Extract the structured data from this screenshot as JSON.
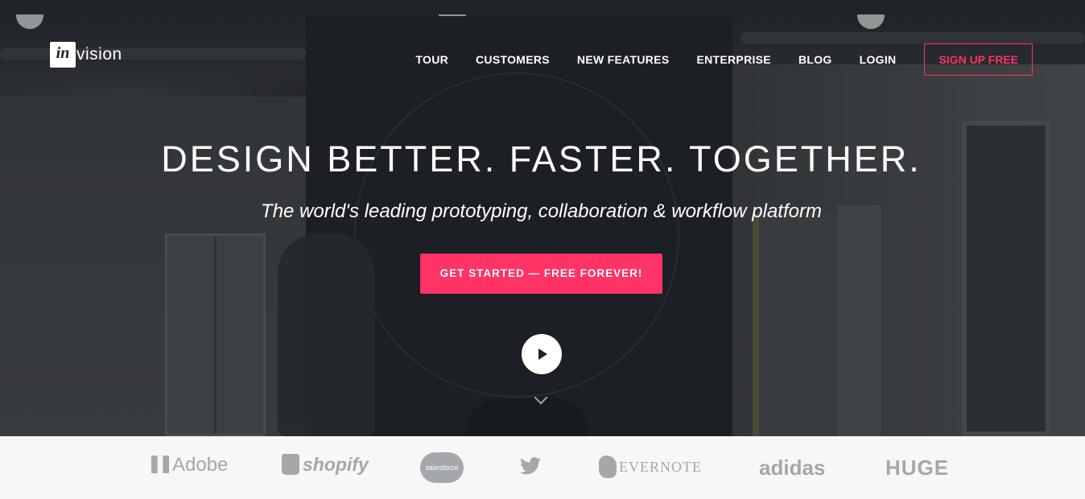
{
  "header": {
    "logo_mark": "in",
    "logo_text": "vision"
  },
  "nav": {
    "items": [
      "TOUR",
      "CUSTOMERS",
      "NEW FEATURES",
      "ENTERPRISE",
      "BLOG",
      "LOGIN"
    ],
    "signup_label": "SIGN UP FREE"
  },
  "hero": {
    "headline": "DESIGN BETTER. FASTER. TOGETHER.",
    "subhead": "The world's leading prototyping, collaboration & workflow platform",
    "cta_label": "GET STARTED — FREE FOREVER!",
    "play_icon": "play-icon",
    "scroll_icon": "chevron-down-icon"
  },
  "customers": {
    "logos": [
      "Adobe",
      "shopify",
      "salesforce",
      "twitter-bird",
      "EVERNOTE",
      "adidas",
      "HUGE"
    ]
  },
  "colors": {
    "accent": "#ff3366",
    "logo_gray": "#a4a7ab"
  }
}
